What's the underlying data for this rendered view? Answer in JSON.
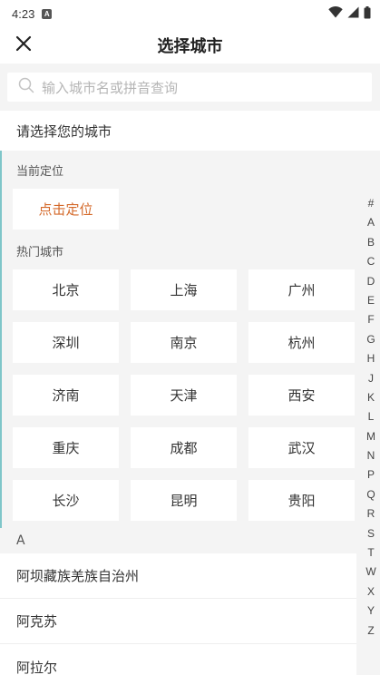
{
  "status_bar": {
    "time": "4:23",
    "app_icon": "A"
  },
  "header": {
    "title": "选择城市"
  },
  "search": {
    "placeholder": "输入城市名或拼音查询"
  },
  "prompt": "请选择您的城市",
  "current_location": {
    "label": "当前定位",
    "button": "点击定位"
  },
  "hot_cities": {
    "label": "热门城市",
    "items": [
      "北京",
      "上海",
      "广州",
      "深圳",
      "南京",
      "杭州",
      "济南",
      "天津",
      "西安",
      "重庆",
      "成都",
      "武汉",
      "长沙",
      "昆明",
      "贵阳"
    ]
  },
  "group": {
    "letter": "A",
    "cities": [
      "阿坝藏族羌族自治州",
      "阿克苏",
      "阿拉尔"
    ]
  },
  "index_letters": [
    "#",
    "A",
    "B",
    "C",
    "D",
    "E",
    "F",
    "G",
    "H",
    "J",
    "K",
    "L",
    "M",
    "N",
    "P",
    "Q",
    "R",
    "S",
    "T",
    "W",
    "X",
    "Y",
    "Z"
  ],
  "colors": {
    "accent_orange": "#d4692a",
    "left_accent": "#7fc6c9",
    "background": "#f4f4f4"
  },
  "icons": {
    "close": "close-icon",
    "search": "search-icon",
    "wifi": "wifi-icon",
    "signal": "signal-icon",
    "battery": "battery-icon"
  }
}
